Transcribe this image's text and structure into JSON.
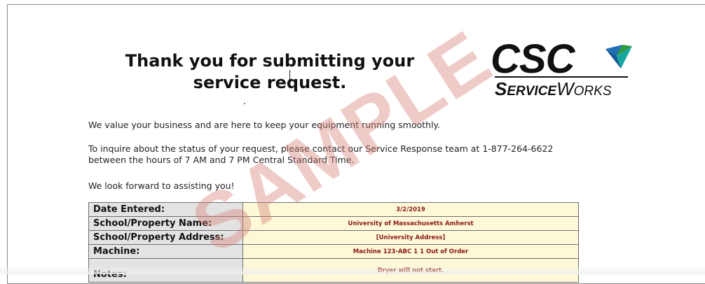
{
  "watermark": "SAMPLE",
  "heading": {
    "line1": "Thank you for submitting your",
    "line2": "service request."
  },
  "logo": {
    "brand": "CSC",
    "service_S": "S",
    "service_rest": "ERVICE",
    "works_W": "W",
    "works_rest": "ORKS",
    "colors": {
      "text": "#111111",
      "accent_blue": "#1f6fb5",
      "accent_green": "#2e9a3a",
      "accent_teal": "#1aa6a0"
    }
  },
  "body": {
    "p1": "We value your business and are here to keep your equipment running smoothly.",
    "p2_line1": "To inquire about the status of your request, please contact our Service Response team at 1-877-264-6622",
    "p2_line2": "between the hours of 7 AM and 7 PM Central Standard Time.",
    "p3": "We look forward to assisting you!"
  },
  "table": {
    "rows": [
      {
        "label": "Date Entered:",
        "value": "3/2/2019"
      },
      {
        "label": "School/Property Name:",
        "value": "University of Massachusetts Amherst"
      },
      {
        "label": "School/Property Address:",
        "value": "[University Address]"
      },
      {
        "label": "Machine:",
        "value": "Machine 123-ABC 1 1 Out of Order"
      },
      {
        "label": "Notes:",
        "value": "Dryer will not start."
      }
    ]
  },
  "colors": {
    "label_bg": "#e3e3e3",
    "value_bg": "#fcf8d8",
    "value_text": "#8b1a1a",
    "watermark": "#d68278"
  }
}
